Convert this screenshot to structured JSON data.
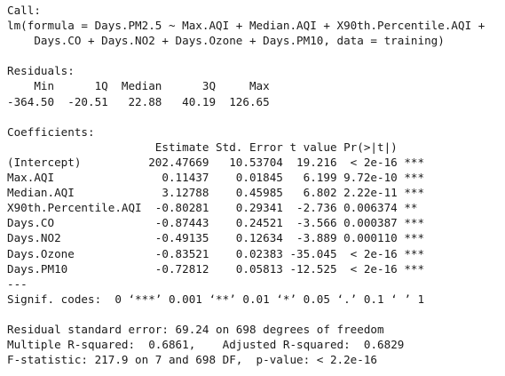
{
  "console": {
    "lines": [
      "Call:",
      "lm(formula = Days.PM2.5 ~ Max.AQI + Median.AQI + X90th.Percentile.AQI +",
      "    Days.CO + Days.NO2 + Days.Ozone + Days.PM10, data = training)",
      "",
      "Residuals:",
      "    Min      1Q  Median      3Q     Max",
      "-364.50  -20.51   22.88   40.19  126.65",
      "",
      "Coefficients:",
      "                      Estimate Std. Error t value Pr(>|t|)    ",
      "(Intercept)          202.47669   10.53704  19.216  < 2e-16 ***",
      "Max.AQI                0.11437    0.01845   6.199 9.72e-10 ***",
      "Median.AQI             3.12788    0.45985   6.802 2.22e-11 ***",
      "X90th.Percentile.AQI  -0.80281    0.29341  -2.736 0.006374 ** ",
      "Days.CO               -0.87443    0.24521  -3.566 0.000387 ***",
      "Days.NO2              -0.49135    0.12634  -3.889 0.000110 ***",
      "Days.Ozone            -0.83521    0.02383 -35.045  < 2e-16 ***",
      "Days.PM10             -0.72812    0.05813 -12.525  < 2e-16 ***",
      "---",
      "Signif. codes:  0 ‘***’ 0.001 ‘**’ 0.01 ‘*’ 0.05 ‘.’ 0.1 ‘ ’ 1",
      "",
      "Residual standard error: 69.24 on 698 degrees of freedom",
      "Multiple R-squared:  0.6861,\tAdjusted R-squared:  0.6829 ",
      "F-statistic: 217.9 on 7 and 698 DF,  p-value: < 2.2e-16"
    ]
  }
}
